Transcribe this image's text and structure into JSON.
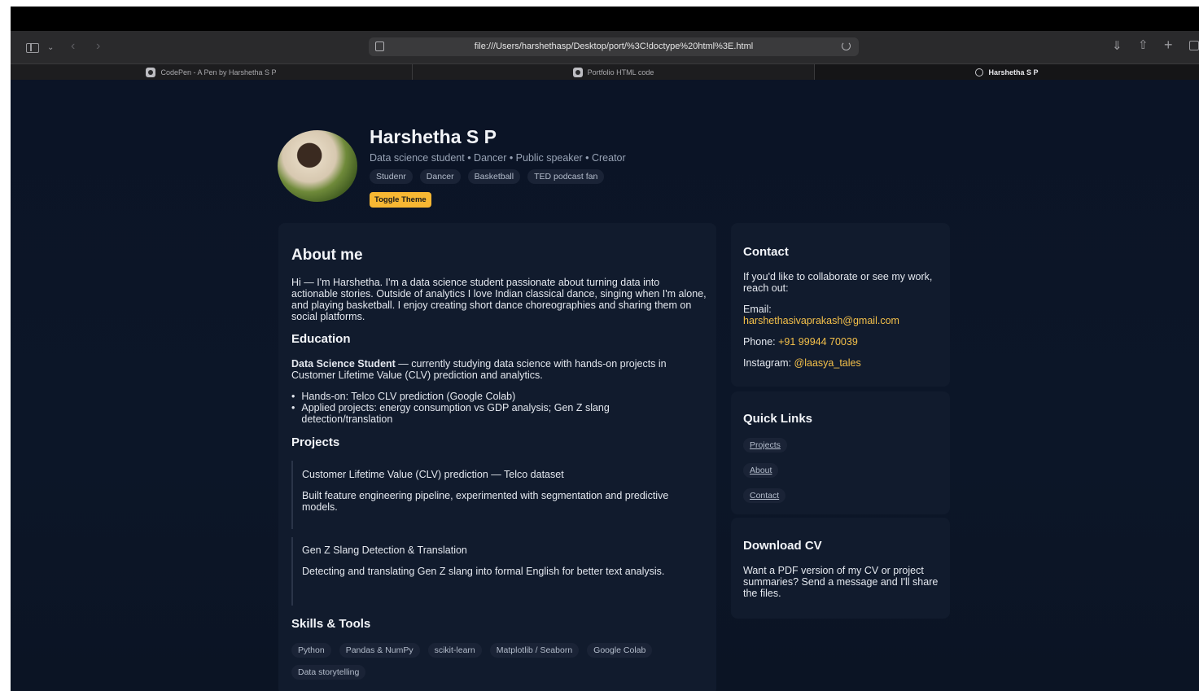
{
  "browser": {
    "url": "file:///Users/harshethasp/Desktop/port/%3C!doctype%20html%3E.html",
    "tabs": [
      {
        "label": "CodePen - A Pen by Harshetha S P",
        "icon": "codepen-icon",
        "active": false
      },
      {
        "label": "Portfolio HTML code",
        "icon": "chatgpt-icon",
        "active": false
      },
      {
        "label": "Harshetha S P",
        "icon": "compass-icon",
        "active": true
      }
    ]
  },
  "header": {
    "name": "Harshetha S P",
    "tagline": "Data science student • Dancer • Public speaker • Creator",
    "tags": [
      "Studenr",
      "Dancer",
      "Basketball",
      "TED podcast fan"
    ],
    "toggle_label": "Toggle Theme"
  },
  "about": {
    "title": "About me",
    "text": "Hi — I'm Harshetha. I'm a data science student passionate about turning data into actionable stories. Outside of analytics I love Indian classical dance, singing when I'm alone, and playing basketball. I enjoy creating short dance choreographies and sharing them on social platforms."
  },
  "education": {
    "title": "Education",
    "degree": "Data Science Student",
    "desc": " — currently studying data science with hands-on projects in Customer Lifetime Value (CLV) prediction and analytics.",
    "bullets": [
      "Hands-on: Telco CLV prediction (Google Colab)",
      "Applied projects: energy consumption vs GDP analysis; Gen Z slang detection/translation"
    ]
  },
  "projects": {
    "title": "Projects",
    "items": [
      {
        "title": "Customer Lifetime Value (CLV) prediction — Telco dataset",
        "desc": "Built feature engineering pipeline, experimented with segmentation and predictive models."
      },
      {
        "title": "Gen Z Slang Detection & Translation",
        "desc": "Detecting and translating Gen Z slang into formal English for better text analysis."
      }
    ]
  },
  "skills": {
    "title": "Skills & Tools",
    "items": [
      "Python",
      "Pandas & NumPy",
      "scikit-learn",
      "Matplotlib / Seaborn",
      "Google Colab",
      "Data storytelling"
    ]
  },
  "contact": {
    "title": "Contact",
    "intro": "If you'd like to collaborate or see my work, reach out:",
    "email_label": "Email:",
    "email": "harshethasivaprakash@gmail.com",
    "phone_label": "Phone:",
    "phone": "+91 99944 70039",
    "instagram_label": "Instagram:",
    "instagram": "@laasya_tales"
  },
  "quick_links": {
    "title": "Quick Links",
    "items": [
      "Projects",
      "About",
      "Contact"
    ]
  },
  "cv": {
    "title": "Download CV",
    "text": "Want a PDF version of my CV or project summaries? Send a message and I'll share the files."
  },
  "colors": {
    "accent": "#f4c04a",
    "background": "#0b1426",
    "card": "#111b2d",
    "button": "#f7b733"
  }
}
